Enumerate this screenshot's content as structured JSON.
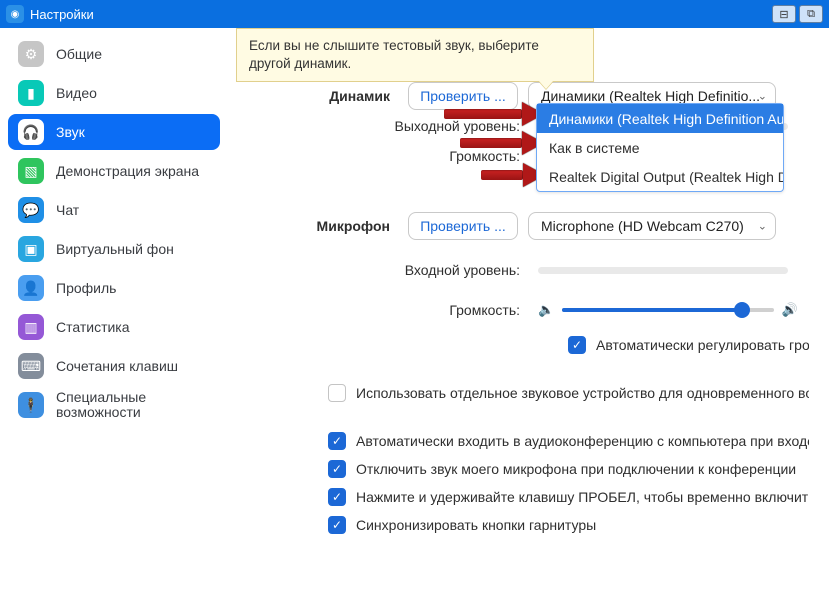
{
  "window": {
    "title": "Настройки"
  },
  "tooltip": "Если вы не слышите тестовый звук, выберите другой динамик.",
  "sidebar": {
    "items": [
      {
        "label": "Общие",
        "icon_bg": "#c6c6c6"
      },
      {
        "label": "Видео",
        "icon_bg": "#08c9b7"
      },
      {
        "label": "Звук",
        "icon_bg": "#0b6df5",
        "active": true
      },
      {
        "label": "Демонстрация экрана",
        "icon_bg": "#2fc55e"
      },
      {
        "label": "Чат",
        "icon_bg": "#1f8fe6"
      },
      {
        "label": "Виртуальный фон",
        "icon_bg": "#29a6e0"
      },
      {
        "label": "Профиль",
        "icon_bg": "#4a9ef0"
      },
      {
        "label": "Статистика",
        "icon_bg": "#9558d6"
      },
      {
        "label": "Сочетания клавиш",
        "icon_bg": "#838d9b"
      },
      {
        "label": "Специальные возможности",
        "icon_bg": "#3e8fe0"
      }
    ]
  },
  "audio": {
    "speaker": {
      "section_label": "Динамик",
      "test_btn": "Проверить ...",
      "selected": "Динамики (Realtek High Definitio...",
      "options": [
        "Динамики (Realtek High Definition Au...",
        "Как в системе",
        "Realtek Digital Output (Realtek High D..."
      ],
      "output_level_label": "Выходной уровень:",
      "volume_label": "Громкость:"
    },
    "mic": {
      "section_label": "Микрофон",
      "test_btn": "Проверить ...",
      "selected": "Microphone (HD Webcam C270)",
      "input_level_label": "Входной уровень:",
      "volume_label": "Громкость:",
      "volume_percent": 85,
      "auto_gain_label": "Автоматически регулировать гром..."
    },
    "separate_device_label": "Использовать отдельное звуковое устройство для одновременного воспро...",
    "checks": [
      "Автоматически входить в аудиоконференцию с компьютера при входе в кон...",
      "Отключить звук моего микрофона при подключении к конференции",
      "Нажмите и удерживайте клавишу ПРОБЕЛ, чтобы временно включить свой з...",
      "Синхронизировать кнопки гарнитуры"
    ]
  }
}
